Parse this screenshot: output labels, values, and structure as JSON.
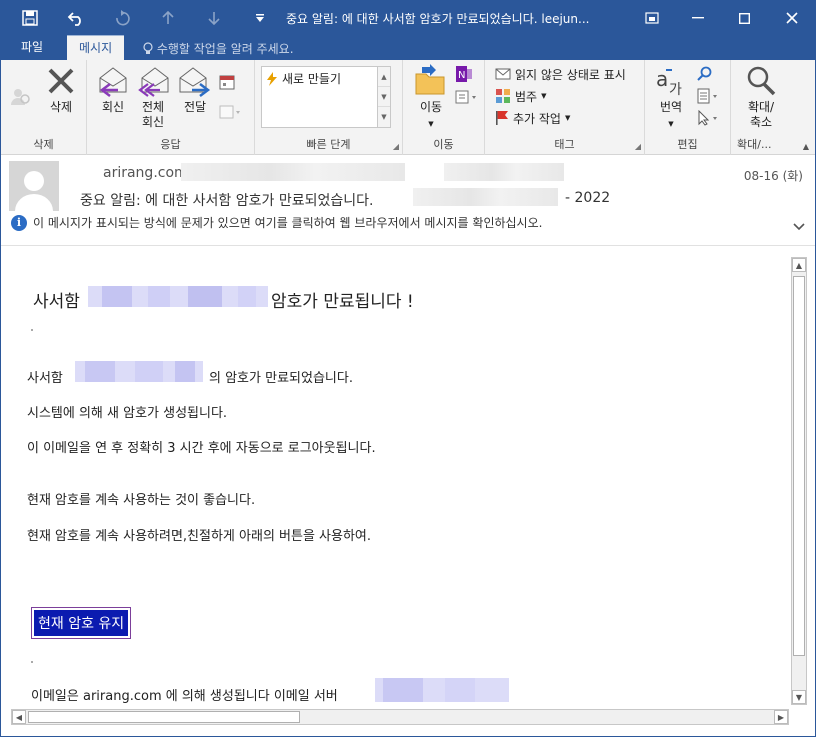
{
  "window": {
    "title": "중요 알림: 에 대한 사서함 암호가 만료되었습니다. leejun...",
    "controls": [
      "restore-down",
      "minimize",
      "maximize",
      "close"
    ]
  },
  "qat": {
    "icons": [
      "save-icon",
      "undo-icon",
      "redo-icon",
      "arrow-up-icon",
      "arrow-down-icon",
      "customize-icon"
    ]
  },
  "tabs": [
    {
      "label": "파일",
      "active": false
    },
    {
      "label": "메시지",
      "active": true
    }
  ],
  "tellme": "수행할 작업을 알려 주세요.",
  "ribbon": {
    "groups": {
      "delete": "삭제",
      "respond": "응답",
      "quick_steps": "빠른 단계",
      "move": "이동",
      "tags": "태그",
      "editing": "편집",
      "zoom": "확대/..."
    },
    "delete_btn": "삭제",
    "reply_btn": "회신",
    "reply_all_btn_1": "전체",
    "reply_all_btn_2": "회신",
    "forward_btn": "전달",
    "quick_step_item": "새로 만들기",
    "move_btn": "이동",
    "mark_unread": "읽지 않은 상태로 표시",
    "categorize": "범주",
    "follow_up": "추가 작업",
    "translate_btn": "번역",
    "zoom_btn_1": "확대/",
    "zoom_btn_2": "축소",
    "accent_color": "#2b579a"
  },
  "header": {
    "from": "arirang.com",
    "date": "08-16 (화)",
    "subject": "중요 알림: 에 대한 사서함 암호가 만료되었습니다.",
    "subject_suffix": "- 2022",
    "infobar": "이 메시지가 표시되는 방식에 문제가 있으면 여기를 클릭하여 웹 브라우저에서 메시지를 확인하십시오."
  },
  "body": {
    "headline_pre": "사서함",
    "headline_post": "암호가 만료됩니다 !",
    "line1_pre": "사서함",
    "line1_post": "의 암호가 만료되었습니다.",
    "line2": "시스템에 의해 새 암호가 생성됩니다.",
    "line3": "이 이메일을 연 후 정확히 3 시간 후에 자동으로 로그아웃됩니다.",
    "line4": "현재 암호를 계속 사용하는 것이 좋습니다.",
    "line5": "현재 암호를 계속 사용하려면,친절하게 아래의 버튼을 사용하여.",
    "button": "현재 암호 유지",
    "footer_pre": "이메일은",
    "footer_domain": "arirang.com",
    "footer_post": "에 의해 생성됩니다 이메일 서버",
    "button_color": "#0b1bb0"
  }
}
